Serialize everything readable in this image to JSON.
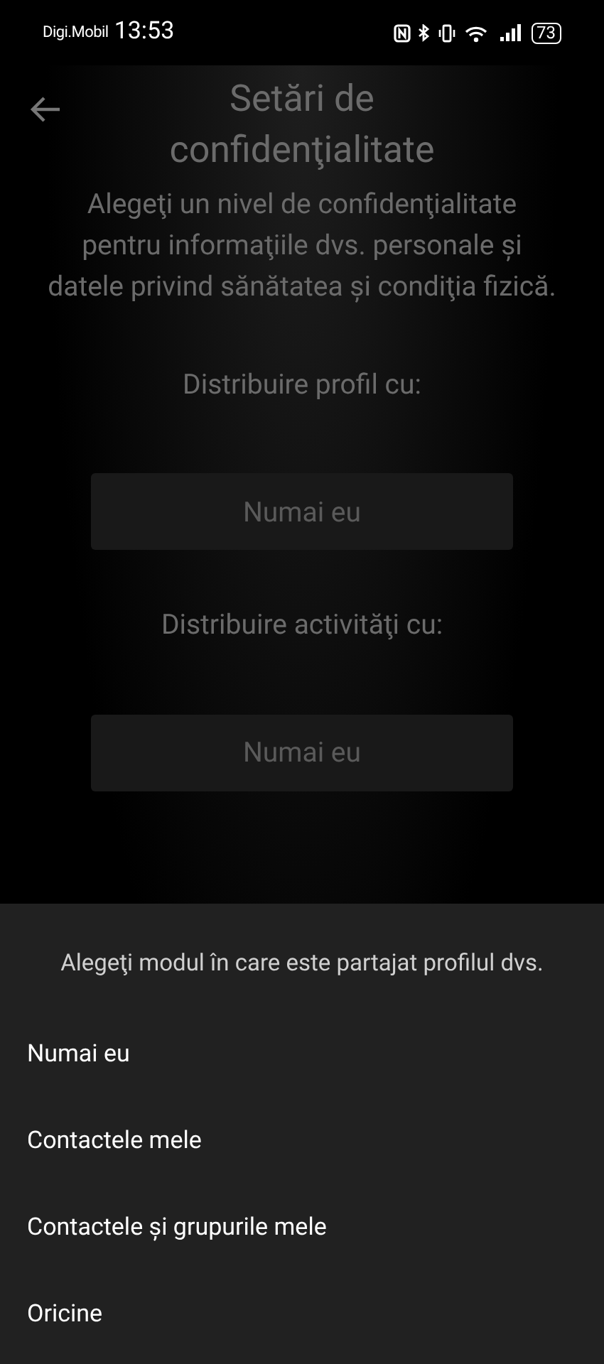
{
  "status_bar": {
    "carrier": "Digi.Mobil",
    "time": "13:53",
    "battery": "73"
  },
  "header": {
    "title": "Setări de confidenţialitate"
  },
  "description": "Alegeţi un nivel de confidenţialitate pentru informaţiile dvs. personale și datele privind sănătatea și condiţia fizică.",
  "settings": [
    {
      "label": "Distribuire profil cu:",
      "value": "Numai eu"
    },
    {
      "label": "Distribuire activităţi cu:",
      "value": "Numai eu"
    }
  ],
  "bottom_sheet": {
    "prompt": "Alegeţi modul în care este partajat profilul dvs.",
    "options": [
      "Numai eu",
      "Contactele mele",
      "Contactele și grupurile mele",
      "Oricine"
    ]
  }
}
